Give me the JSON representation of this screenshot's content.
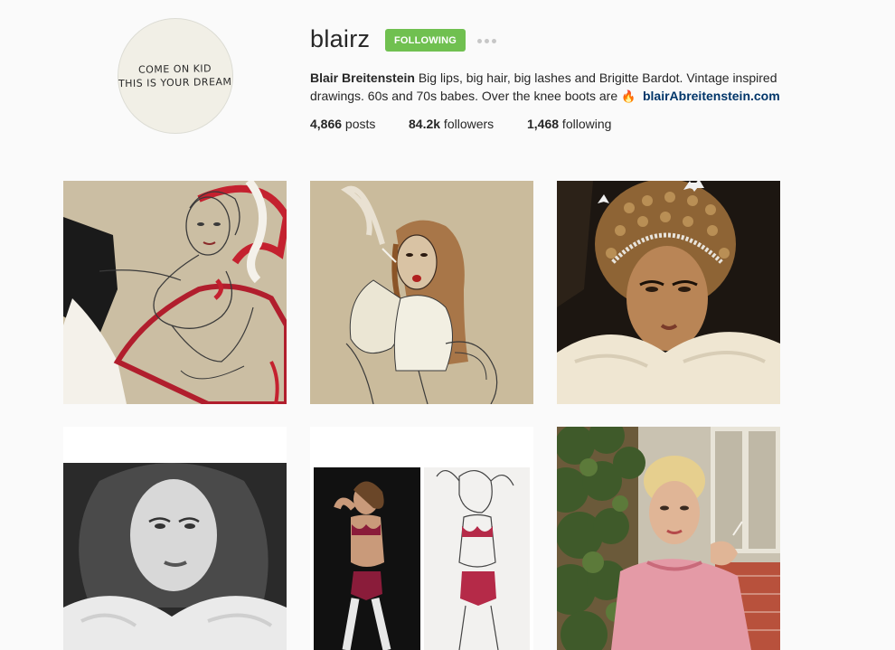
{
  "profile": {
    "avatar_text_line1": "COME ON KID",
    "avatar_text_line2": "THIS IS YOUR DREAM",
    "username": "blairz",
    "follow_button_label": "FOLLOWING",
    "bio_name": "Blair Breitenstein",
    "bio_text": " Big lips, big hair, big lashes and Brigitte Bardot. Vintage inspired drawings. 60s and 70s babes. Over the knee boots are ",
    "bio_emoji": "🔥",
    "website": "blairAbreitenstein.com"
  },
  "stats": {
    "posts_count": "4,866",
    "posts_label": " posts",
    "followers_count": "84.2k",
    "followers_label": " followers",
    "following_count": "1,468",
    "following_label": " following"
  },
  "colors": {
    "following_button": "#70c050",
    "link": "#003569",
    "background": "#fafafa"
  },
  "posts": [
    {
      "subject": "pencil sketch of woman with red and white painted strokes"
    },
    {
      "subject": "drawing of woman with long hair smoking in white coat"
    },
    {
      "subject": "photo of 60s woman in jeweled headdress and fur"
    },
    {
      "subject": "black and white photo of woman with fur collar"
    },
    {
      "subject": "photo and drawing of woman in burgundy lingerie"
    },
    {
      "subject": "photo of blonde 60s woman in pink top among plants"
    }
  ]
}
